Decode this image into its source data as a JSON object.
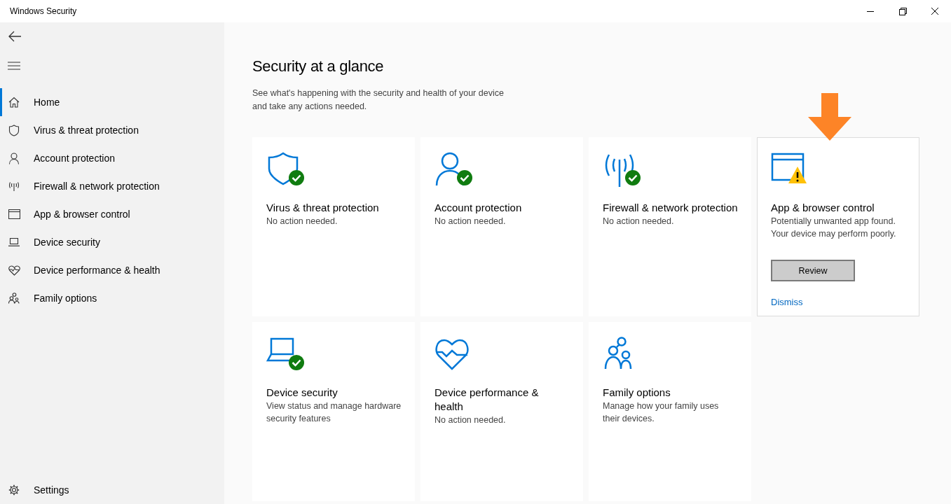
{
  "window": {
    "title": "Windows Security"
  },
  "sidebar": {
    "items": [
      {
        "label": "Home",
        "selected": true
      },
      {
        "label": "Virus & threat protection",
        "selected": false
      },
      {
        "label": "Account protection",
        "selected": false
      },
      {
        "label": "Firewall & network protection",
        "selected": false
      },
      {
        "label": "App & browser control",
        "selected": false
      },
      {
        "label": "Device security",
        "selected": false
      },
      {
        "label": "Device performance & health",
        "selected": false
      },
      {
        "label": "Family options",
        "selected": false
      }
    ],
    "settings": "Settings"
  },
  "main": {
    "title": "Security at a glance",
    "description": "See what's happening with the security and health of your device and take any actions needed.",
    "cards": [
      {
        "kind": "ok",
        "title": "Virus & threat protection",
        "description": "No action needed.",
        "highlighted": false
      },
      {
        "kind": "ok",
        "title": "Account protection",
        "description": "No action needed.",
        "highlighted": false
      },
      {
        "kind": "ok",
        "title": "Firewall & network protection",
        "description": "No action needed.",
        "highlighted": false
      },
      {
        "kind": "warning",
        "title": "App & browser control",
        "description": "Potentially unwanted app found. Your device may perform poorly.",
        "highlighted": true,
        "button": "Review",
        "link": "Dismiss"
      },
      {
        "kind": "ok",
        "title": "Device security",
        "description": "View status and manage hardware security features",
        "highlighted": false
      },
      {
        "kind": "plain",
        "title": "Device performance & health",
        "description": "No action needed.",
        "highlighted": false
      },
      {
        "kind": "plain",
        "title": "Family options",
        "description": "Manage how your family uses their devices.",
        "highlighted": false
      }
    ]
  }
}
